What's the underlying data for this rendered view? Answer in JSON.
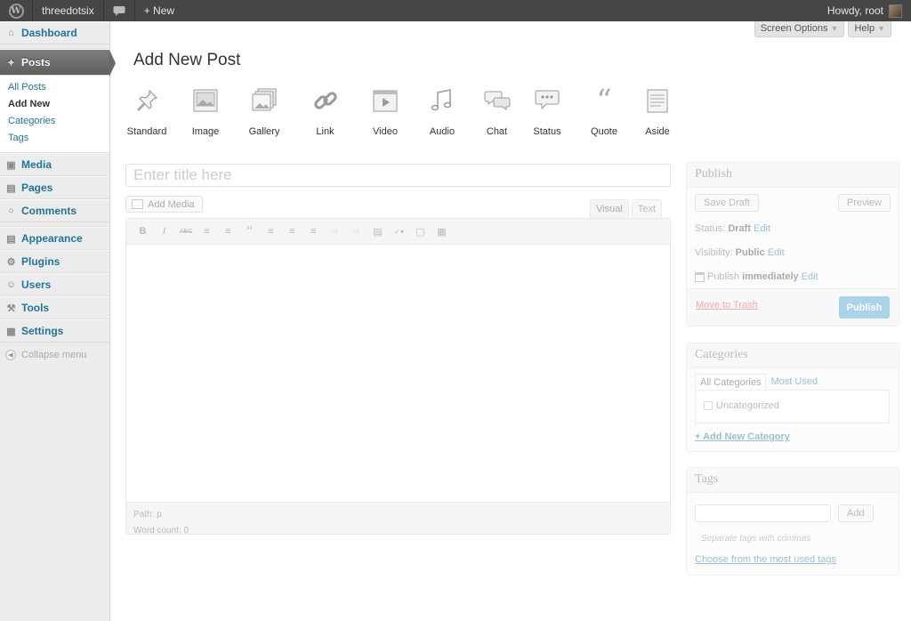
{
  "adminbar": {
    "logo": "W",
    "site_name": "threedotsix",
    "comments_icon": "speech-bubble-icon",
    "new_label": "+ New",
    "howdy": "Howdy, root"
  },
  "sidebar": {
    "items": [
      {
        "label": "Dashboard",
        "icon": "home-icon"
      },
      {
        "label": "Posts",
        "icon": "pushpin-icon"
      },
      {
        "label": "Media",
        "icon": "media-icon"
      },
      {
        "label": "Pages",
        "icon": "pages-icon"
      },
      {
        "label": "Comments",
        "icon": "comments-icon"
      },
      {
        "label": "Appearance",
        "icon": "appearance-icon"
      },
      {
        "label": "Plugins",
        "icon": "plugin-icon"
      },
      {
        "label": "Users",
        "icon": "users-icon"
      },
      {
        "label": "Tools",
        "icon": "tools-icon"
      },
      {
        "label": "Settings",
        "icon": "settings-icon"
      }
    ],
    "submenu": [
      "All Posts",
      "Add New",
      "Categories",
      "Tags"
    ],
    "collapse": "Collapse menu"
  },
  "screen_meta": {
    "screen_options": "Screen Options",
    "help": "Help"
  },
  "page_title": "Add New Post",
  "formats": [
    "Standard",
    "Image",
    "Gallery",
    "Link",
    "Video",
    "Audio",
    "Chat",
    "Status",
    "Quote",
    "Aside"
  ],
  "editor": {
    "title_placeholder": "Enter title here",
    "add_media": "Add Media",
    "tab_visual": "Visual",
    "tab_text": "Text",
    "path": "Path: p",
    "word_count": "Word count: 0"
  },
  "publish": {
    "heading": "Publish",
    "save_draft": "Save Draft",
    "preview": "Preview",
    "status_label": "Status:",
    "status_value": "Draft",
    "visibility_label": "Visibility:",
    "visibility_value": "Public",
    "publish_label": "Publish",
    "publish_value": "immediately",
    "edit": "Edit",
    "trash": "Move to Trash",
    "publish_button": "Publish"
  },
  "categories": {
    "heading": "Categories",
    "tab_all": "All Categories",
    "tab_most": "Most Used",
    "item": "Uncategorized",
    "add_new": "+ Add New Category"
  },
  "tags": {
    "heading": "Tags",
    "add": "Add",
    "hint": "Separate tags with commas",
    "most_used": "Choose from the most used tags"
  }
}
